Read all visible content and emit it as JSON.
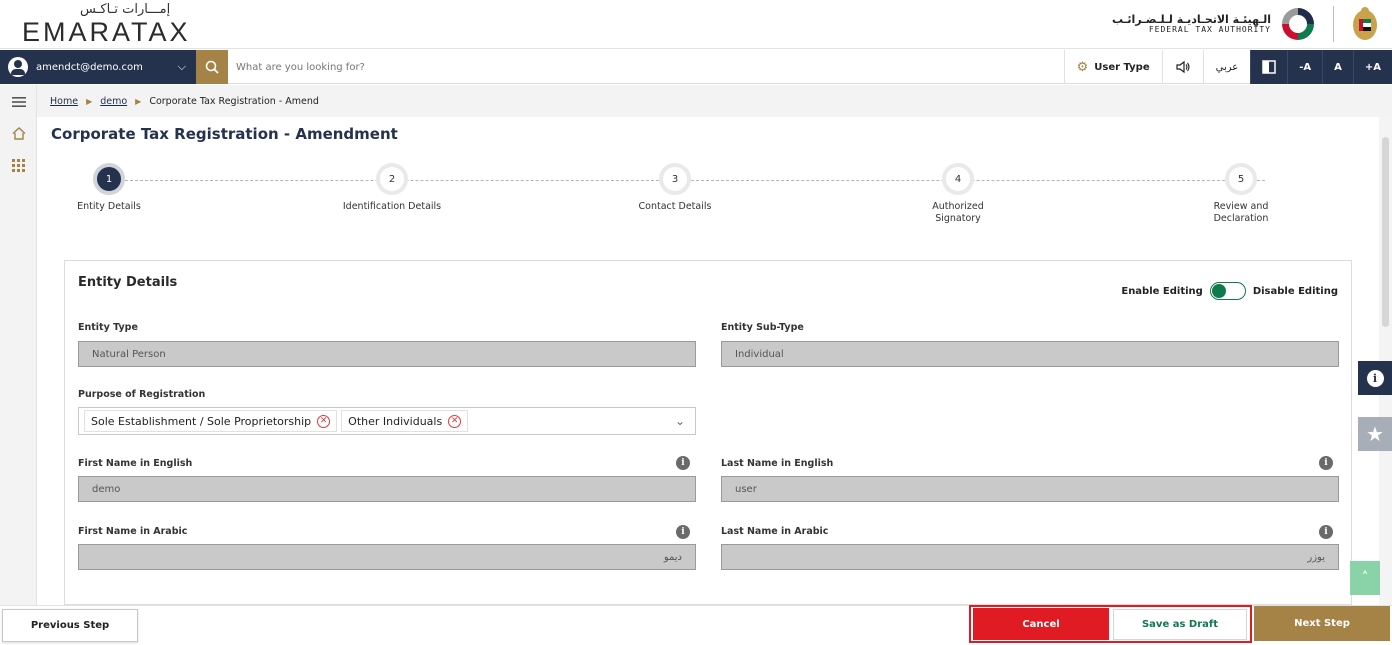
{
  "header": {
    "logo_ar": "إمـــارات تـاكـس",
    "logo_en": "EMARATAX",
    "fta_ar": "الـهيئـة الاتحـاديـة لـلـضـرائـب",
    "fta_en": "FEDERAL TAX AUTHORITY"
  },
  "topnav": {
    "user_email": "amendct@demo.com",
    "search_placeholder": "What are you looking for?",
    "user_type_label": "User Type",
    "language_label": "عربي",
    "font_decrease": "-A",
    "font_normal": "A",
    "font_increase": "+A"
  },
  "breadcrumb": {
    "home": "Home",
    "demo": "demo",
    "current": "Corporate Tax Registration - Amend"
  },
  "page_title": "Corporate Tax Registration - Amendment",
  "stepper": {
    "steps": [
      {
        "number": "1",
        "label": "Entity Details"
      },
      {
        "number": "2",
        "label": "Identification Details"
      },
      {
        "number": "3",
        "label": "Contact Details"
      },
      {
        "number": "4",
        "label": "Authorized Signatory"
      },
      {
        "number": "5",
        "label": "Review and Declaration"
      }
    ],
    "active_step": 1
  },
  "form": {
    "section_title": "Entity Details",
    "enable_editing": "Enable Editing",
    "disable_editing": "Disable Editing",
    "entity_type_label": "Entity Type",
    "entity_type_value": "Natural Person",
    "entity_subtype_label": "Entity Sub-Type",
    "entity_subtype_value": "Individual",
    "purpose_label": "Purpose of Registration",
    "purpose_chips": [
      "Sole Establishment / Sole Proprietorship",
      "Other Individuals"
    ],
    "first_name_en_label": "First Name in English",
    "first_name_en_value": "demo",
    "last_name_en_label": "Last Name in English",
    "last_name_en_value": "user",
    "first_name_ar_label": "First Name in Arabic",
    "first_name_ar_value": "ديمو",
    "last_name_ar_label": "Last Name in Arabic",
    "last_name_ar_value": "يوزر"
  },
  "footer": {
    "previous": "Previous Step",
    "cancel": "Cancel",
    "save_draft": "Save as Draft",
    "next": "Next Step"
  },
  "colors": {
    "navy": "#25324d",
    "gold": "#a58246",
    "cancel_red": "#e01b24",
    "green": "#0f7a4e"
  },
  "icons": [
    "user-avatar-icon",
    "chevron-down-icon",
    "search-icon",
    "gear-icon",
    "speaker-icon",
    "contrast-icon",
    "menu-icon",
    "home-icon",
    "grid-icon",
    "info-icon",
    "star-icon",
    "double-chevron-up-icon",
    "remove-chip-icon"
  ]
}
